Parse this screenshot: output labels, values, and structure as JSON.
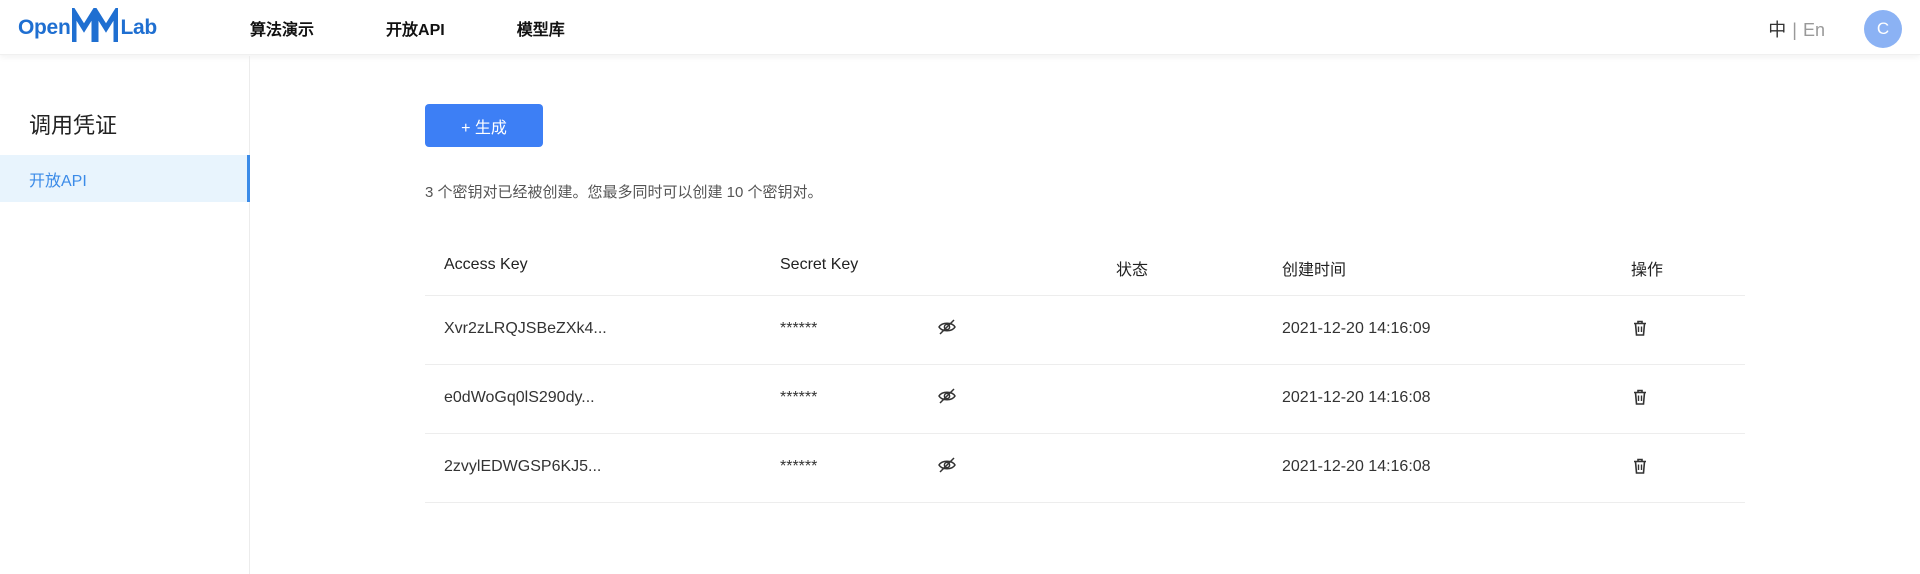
{
  "brand": {
    "text_left": "Open",
    "text_right": "Lab",
    "logo_color": "#1f6fd1"
  },
  "nav": {
    "items": [
      {
        "label": "算法演示"
      },
      {
        "label": "开放API"
      },
      {
        "label": "模型库"
      }
    ]
  },
  "lang": {
    "zh": "中",
    "sep": "|",
    "en": "En"
  },
  "user": {
    "avatar_initial": "C"
  },
  "sidebar": {
    "title": "调用凭证",
    "active_item": "开放API"
  },
  "main": {
    "generate_label": "+ 生成",
    "info_text": "3 个密钥对已经被创建。您最多同时可以创建 10 个密钥对。"
  },
  "table": {
    "headers": {
      "access_key": "Access Key",
      "secret_key": "Secret Key",
      "status": "状态",
      "created": "创建时间",
      "action": "操作"
    },
    "rows": [
      {
        "access_key": "Xvr2zLRQJSBeZXk4...",
        "secret_key": "******",
        "enabled": true,
        "created": "2021-12-20 14:16:09"
      },
      {
        "access_key": "e0dWoGq0lS290dy...",
        "secret_key": "******",
        "enabled": true,
        "created": "2021-12-20 14:16:08"
      },
      {
        "access_key": "2zvylEDWGSP6KJ5...",
        "secret_key": "******",
        "enabled": true,
        "created": "2021-12-20 14:16:08"
      }
    ]
  },
  "colors": {
    "accent": "#3d7ff5",
    "sidebar_active_bg": "#e8f4fd",
    "sidebar_active_text": "#3b8be8"
  },
  "icons": {
    "visibility": "eye-off-icon",
    "delete": "trash-icon"
  }
}
